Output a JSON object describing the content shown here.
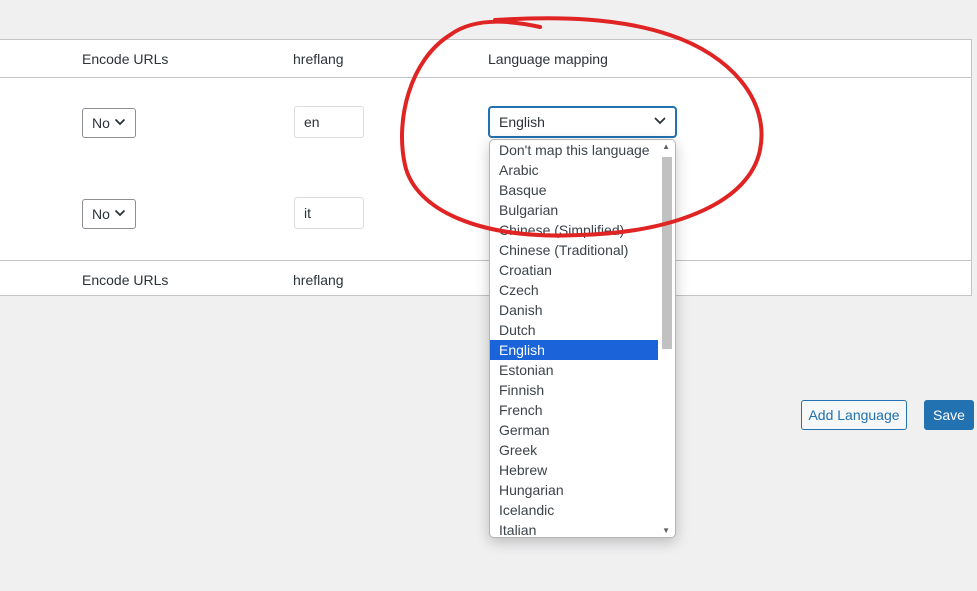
{
  "table": {
    "header": {
      "encode_urls": "Encode URLs",
      "hreflang": "hreflang",
      "language_mapping": "Language mapping"
    },
    "footer": {
      "encode_urls": "Encode URLs",
      "hreflang": "hreflang"
    },
    "rows": [
      {
        "encode_urls": "No",
        "hreflang": "en",
        "language_mapping": "English"
      },
      {
        "encode_urls": "No",
        "hreflang": "it"
      }
    ]
  },
  "dropdown": {
    "selected": "English",
    "options": [
      "Don't map this language",
      "Arabic",
      "Basque",
      "Bulgarian",
      "Chinese (Simplified)",
      "Chinese (Traditional)",
      "Croatian",
      "Czech",
      "Danish",
      "Dutch",
      "English",
      "Estonian",
      "Finnish",
      "French",
      "German",
      "Greek",
      "Hebrew",
      "Hungarian",
      "Icelandic",
      "Italian"
    ]
  },
  "buttons": {
    "add_language": "Add Language",
    "save": "Save"
  },
  "colors": {
    "accent": "#2271b1",
    "selected_option": "#1a63d8",
    "annotation": "#e02424"
  },
  "icons": {
    "chevron": "chevron-down-icon"
  }
}
